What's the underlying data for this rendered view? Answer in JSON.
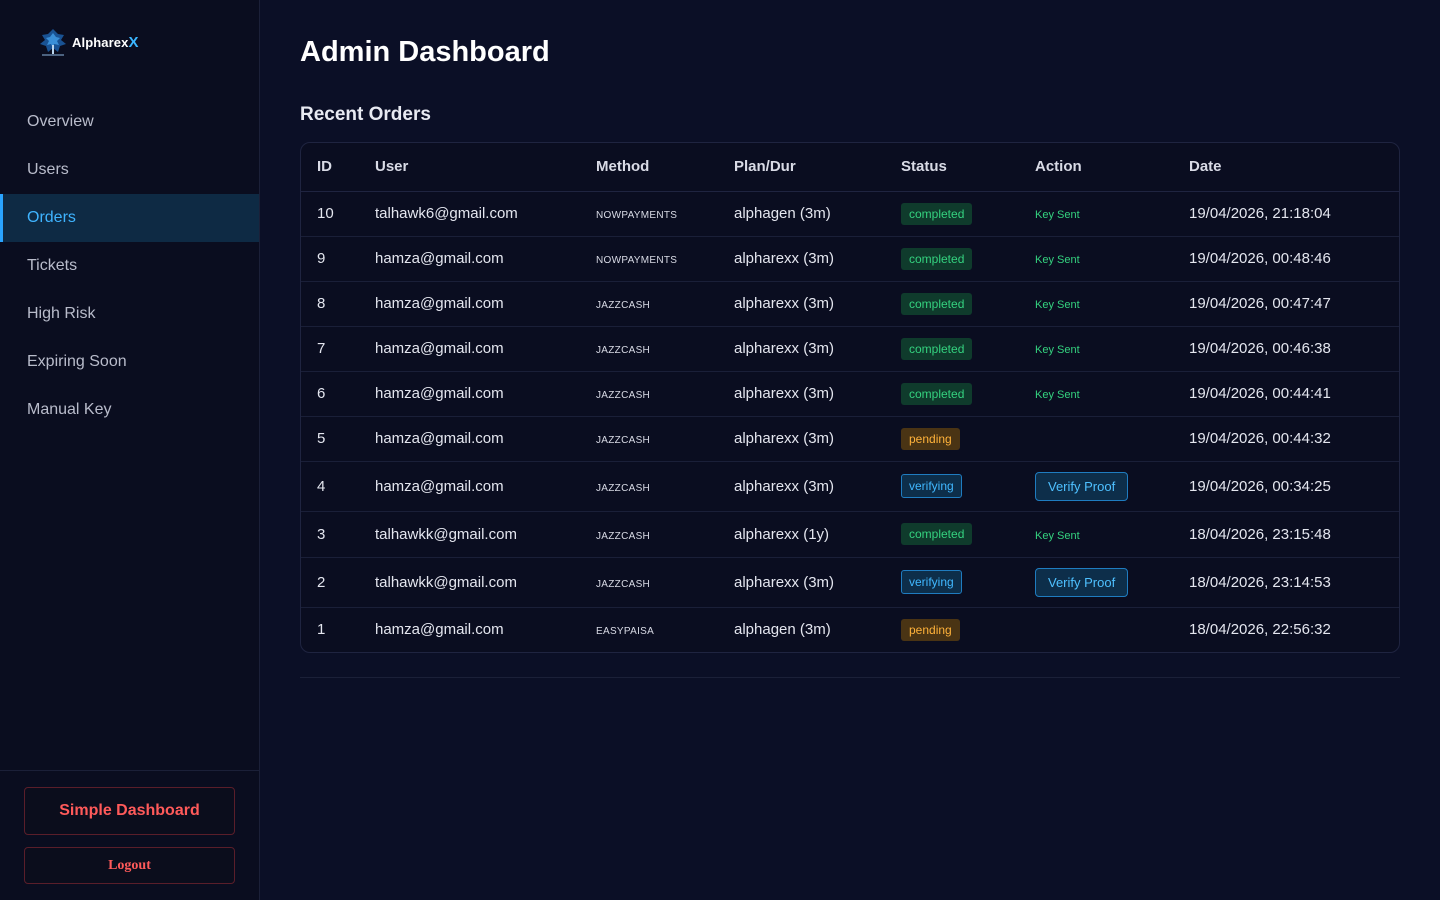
{
  "brand": {
    "name": "Alpharex",
    "name_suffix": "X"
  },
  "sidebar": {
    "items": [
      {
        "label": "Overview",
        "active": false
      },
      {
        "label": "Users",
        "active": false
      },
      {
        "label": "Orders",
        "active": true
      },
      {
        "label": "Tickets",
        "active": false
      },
      {
        "label": "High Risk",
        "active": false
      },
      {
        "label": "Expiring Soon",
        "active": false
      },
      {
        "label": "Manual Key",
        "active": false
      }
    ],
    "simple_dashboard_label": "Simple Dashboard",
    "logout_label": "Logout"
  },
  "main": {
    "title": "Admin Dashboard",
    "section_title": "Recent Orders",
    "table": {
      "headers": [
        "ID",
        "User",
        "Method",
        "Plan/Dur",
        "Status",
        "Action",
        "Date"
      ],
      "rows": [
        {
          "id": "10",
          "user": "talhawk6@gmail.com",
          "method": "NOWPAYMENTS",
          "plan": "alphagen (3m)",
          "status": "completed",
          "action": "Key Sent",
          "action_type": "text",
          "date": "19/04/2026, 21:18:04"
        },
        {
          "id": "9",
          "user": "hamza@gmail.com",
          "method": "NOWPAYMENTS",
          "plan": "alpharexx (3m)",
          "status": "completed",
          "action": "Key Sent",
          "action_type": "text",
          "date": "19/04/2026, 00:48:46"
        },
        {
          "id": "8",
          "user": "hamza@gmail.com",
          "method": "JAZZCASH",
          "plan": "alpharexx (3m)",
          "status": "completed",
          "action": "Key Sent",
          "action_type": "text",
          "date": "19/04/2026, 00:47:47"
        },
        {
          "id": "7",
          "user": "hamza@gmail.com",
          "method": "JAZZCASH",
          "plan": "alpharexx (3m)",
          "status": "completed",
          "action": "Key Sent",
          "action_type": "text",
          "date": "19/04/2026, 00:46:38"
        },
        {
          "id": "6",
          "user": "hamza@gmail.com",
          "method": "JAZZCASH",
          "plan": "alpharexx (3m)",
          "status": "completed",
          "action": "Key Sent",
          "action_type": "text",
          "date": "19/04/2026, 00:44:41"
        },
        {
          "id": "5",
          "user": "hamza@gmail.com",
          "method": "JAZZCASH",
          "plan": "alpharexx (3m)",
          "status": "pending",
          "action": "",
          "action_type": "none",
          "date": "19/04/2026, 00:44:32"
        },
        {
          "id": "4",
          "user": "hamza@gmail.com",
          "method": "JAZZCASH",
          "plan": "alpharexx (3m)",
          "status": "verifying",
          "action": "Verify Proof",
          "action_type": "button",
          "date": "19/04/2026, 00:34:25"
        },
        {
          "id": "3",
          "user": "talhawkk@gmail.com",
          "method": "JAZZCASH",
          "plan": "alpharexx (1y)",
          "status": "completed",
          "action": "Key Sent",
          "action_type": "text",
          "date": "18/04/2026, 23:15:48"
        },
        {
          "id": "2",
          "user": "talhawkk@gmail.com",
          "method": "JAZZCASH",
          "plan": "alpharexx (3m)",
          "status": "verifying",
          "action": "Verify Proof",
          "action_type": "button",
          "date": "18/04/2026, 23:14:53"
        },
        {
          "id": "1",
          "user": "hamza@gmail.com",
          "method": "EASYPAISA",
          "plan": "alphagen (3m)",
          "status": "pending",
          "action": "",
          "action_type": "none",
          "date": "18/04/2026, 22:56:32"
        }
      ]
    }
  },
  "colors": {
    "accent": "#2aa4ff",
    "completed": "#34d27f",
    "pending": "#ffb23a",
    "danger": "#ff5a5a",
    "background": "#0b0f26"
  }
}
